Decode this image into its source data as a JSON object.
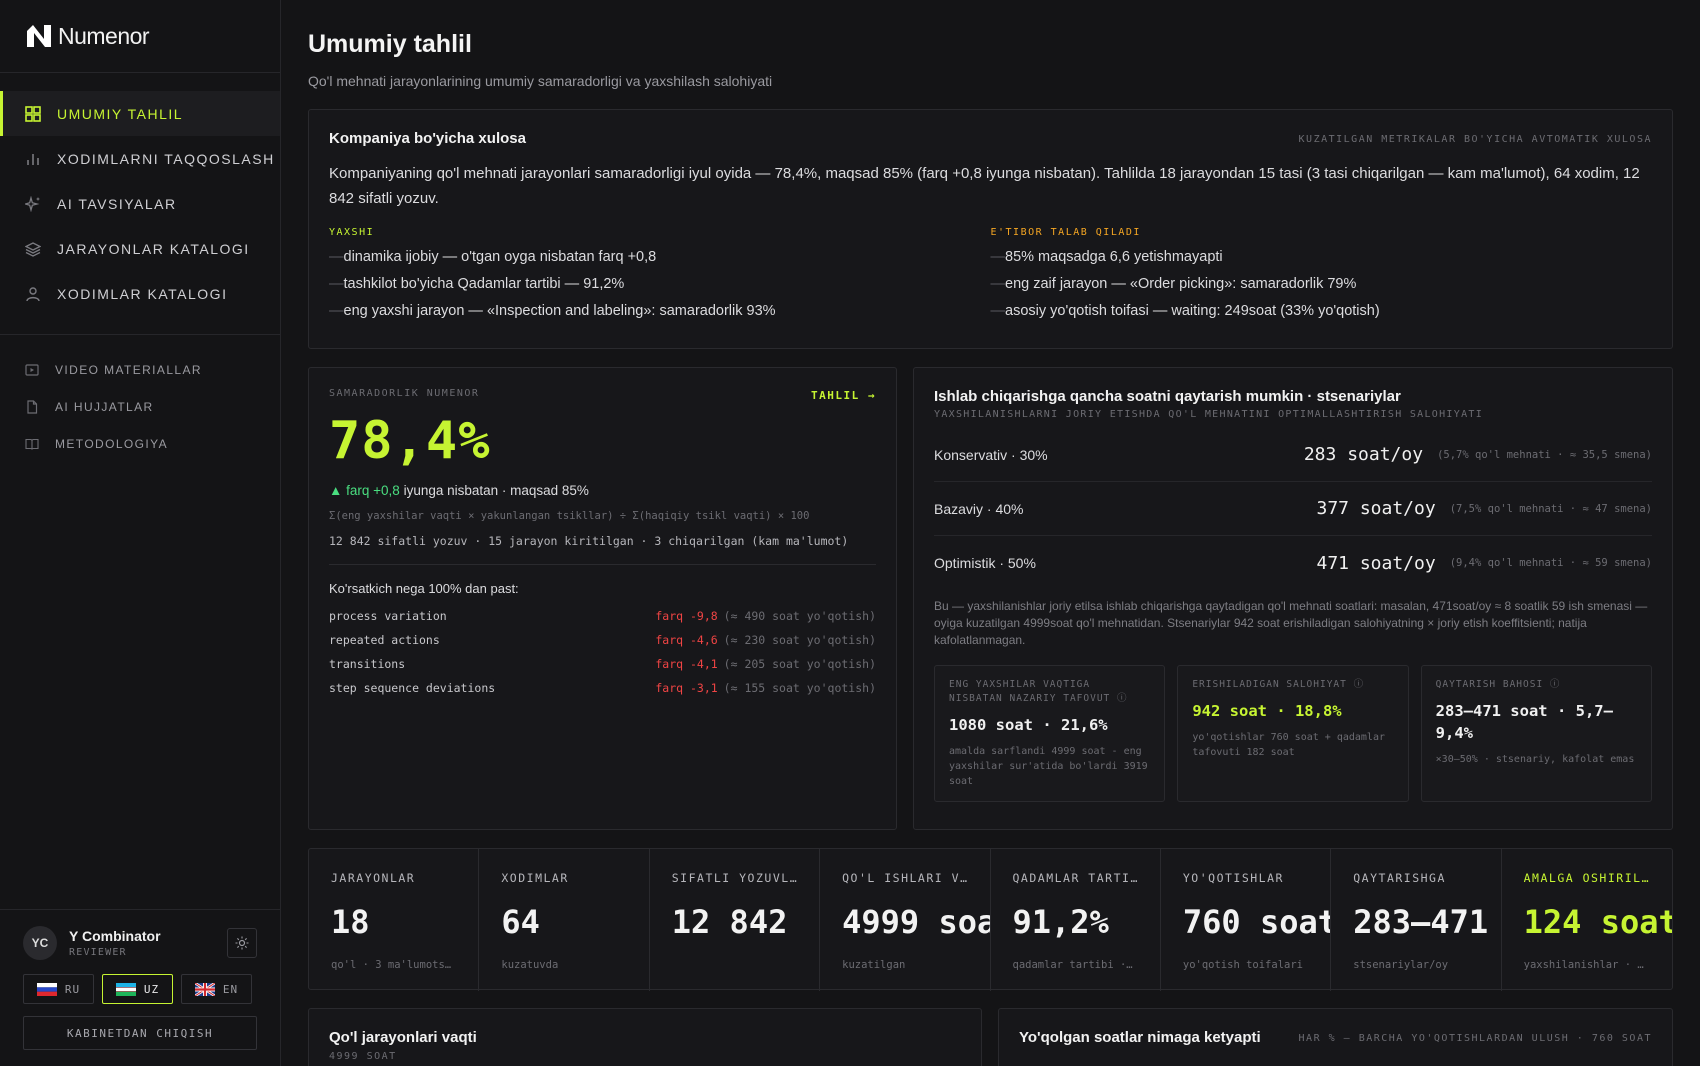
{
  "brand": {
    "name": "Numenor"
  },
  "colors": {
    "accent": "#c6f432",
    "warning": "#f5a623",
    "negative": "#ef4444",
    "positive": "#4ade80"
  },
  "sidebar": {
    "main_items": [
      {
        "label": "UMUMIY TAHLIL",
        "icon": "grid-icon",
        "active": true
      },
      {
        "label": "XODIMLARNI TAQQOSLASH",
        "icon": "bar-chart-icon"
      },
      {
        "label": "AI TAVSIYALAR",
        "icon": "sparkles-icon"
      },
      {
        "label": "JARAYONLAR KATALOGI",
        "icon": "layers-icon"
      },
      {
        "label": "XODIMLAR KATALOGI",
        "icon": "user-icon"
      }
    ],
    "secondary_items": [
      {
        "label": "VIDEO MATERIALLAR",
        "icon": "video-icon"
      },
      {
        "label": "AI HUJJATLAR",
        "icon": "document-icon"
      },
      {
        "label": "METODOLOGIYA",
        "icon": "book-icon"
      }
    ],
    "user": {
      "initials": "YC",
      "name": "Y Combinator",
      "role": "REVIEWER"
    },
    "languages": [
      {
        "code": "RU",
        "active": false
      },
      {
        "code": "UZ",
        "active": true
      },
      {
        "code": "EN",
        "active": false
      }
    ],
    "logout_label": "KABINETDAN CHIQISH"
  },
  "page": {
    "title": "Umumiy tahlil",
    "subtitle": "Qo'l mehnati jarayonlarining umumiy samaradorligi va yaxshilash salohiyati"
  },
  "summary": {
    "title": "Kompaniya bo'yicha xulosa",
    "tag": "KUZATILGAN METRIKALAR BO'YICHA AVTOMATIK XULOSA",
    "text": "Kompaniyaning qo'l mehnati jarayonlari samaradorligi iyul oyida — 78,4%, maqsad 85% (farq +0,8 iyunga nisbatan). Tahlilda 18 jarayondan 15 tasi (3 tasi chiqarilgan — kam ma'lumot), 64 xodim, 12 842 sifatli yozuv.",
    "good_title": "YAXSHI",
    "good": [
      "dinamika ijobiy — o'tgan oyga nisbatan farq +0,8",
      "tashkilot bo'yicha Qadamlar tartibi — 91,2%",
      "eng yaxshi jarayon — «Inspection and labeling»: samaradorlik 93%"
    ],
    "warn_title": "E'TIBOR TALAB QILADI",
    "warn": [
      "85% maqsadga 6,6 yetishmayapti",
      "eng zaif jarayon — «Order picking»: samaradorlik 79%",
      "asosiy yo'qotish toifasi — waiting: 249soat (33% yo'qotish)"
    ]
  },
  "efficiency": {
    "label": "SAMARADORLIK NUMENOR",
    "link": "TAHLIL →",
    "value": "78,4%",
    "delta_arrow": "▲",
    "delta_value": "farq +0,8",
    "delta_text": " iyunga nisbatan · maqsad 85%",
    "formula": "Σ(eng yaxshilar vaqti × yakunlangan tsikllar) ÷ Σ(haqiqiy tsikl vaqti) × 100",
    "meta": "12 842 sifatli yozuv · 15 jarayon kiritilgan · 3 chiqarilgan (kam ma'lumot)",
    "why_title": "Ko'rsatkich nega 100% dan past:",
    "losses": [
      {
        "name": "process variation",
        "value": "farq -9,8",
        "hours": "(≈ 490 soat yo'qotish)"
      },
      {
        "name": "repeated actions",
        "value": "farq -4,6",
        "hours": "(≈ 230 soat yo'qotish)"
      },
      {
        "name": "transitions",
        "value": "farq -4,1",
        "hours": "(≈ 205 soat yo'qotish)"
      },
      {
        "name": "step sequence deviations",
        "value": "farq -3,1",
        "hours": "(≈ 155 soat yo'qotish)"
      }
    ]
  },
  "scenarios": {
    "title": "Ishlab chiqarishga qancha soatni qaytarish mumkin · stsenariylar",
    "subtitle": "YAXSHILANISHLARNI JORIY ETISHDA QO'L MEHNATINI OPTIMALLASHTIRISH SALOHIYATI",
    "rows": [
      {
        "name": "Konservativ · 30%",
        "value": "283 soat/oy",
        "note": "(5,7% qo'l mehnati · ≈ 35,5 smena)"
      },
      {
        "name": "Bazaviy · 40%",
        "value": "377 soat/oy",
        "note": "(7,5% qo'l mehnati · ≈ 47 smena)"
      },
      {
        "name": "Optimistik · 50%",
        "value": "471 soat/oy",
        "note": "(9,4% qo'l mehnati · ≈ 59 smena)"
      }
    ],
    "description": "Bu — yaxshilanishlar joriy etilsa ishlab chiqarishga qaytadigan qo'l mehnati soatlari: masalan, 471soat/oy ≈ 8 soatlik 59 ish smenasi — oyiga kuzatilgan 4999soat qo'l mehnatidan. Stsenariylar 942 soat erishiladigan salohiyatning × joriy etish koeffitsienti; natija kafolatlanmagan.",
    "minis": [
      {
        "label": "ENG YAXSHILAR VAQTIGA NISBATAN NAZARIY TAFOVUT ⓘ",
        "value": "1080 soat · 21,6%",
        "note": "amalda sarflandi 4999 soat - eng yaxshilar sur'atida bo'lardi 3919 soat",
        "lime": false
      },
      {
        "label": "ERISHILADIGAN SALOHIYAT ⓘ",
        "value": "942 soat · 18,8%",
        "note": "yo'qotishlar 760 soat + qadamlar tafovuti 182 soat",
        "lime": true
      },
      {
        "label": "QAYTARISH BAHOSI ⓘ",
        "value": "283–471 soat · 5,7–9,4%",
        "note": "×30–50% · stsenariy, kafolat emas",
        "lime": false
      }
    ]
  },
  "kpis": [
    {
      "label": "JARAYONLAR",
      "value": "18",
      "sub": "qo'l · 3 ma'lumotsiz",
      "lime": false
    },
    {
      "label": "XODIMLAR",
      "value": "64",
      "sub": "kuzatuvda",
      "lime": false
    },
    {
      "label": "SIFATLI YOZUVLAR",
      "value": "12 842",
      "sub": "",
      "lime": false
    },
    {
      "label": "QO'L ISHLARI VA…",
      "value": "4999 soa",
      "sub": "kuzatilgan",
      "lime": false
    },
    {
      "label": "QADAMLAR TARTIBI",
      "value": "91,2%",
      "sub": "qadamlar tartibi · …",
      "lime": false
    },
    {
      "label": "YO'QOTISHLAR",
      "value": "760 soat",
      "sub": "yo'qotish toifalari",
      "lime": false
    },
    {
      "label": "QAYTARISHGA",
      "value": "283–471",
      "sub": "stsenariylar/oy",
      "lime": false
    },
    {
      "label": "AMALGA OSHIRILG…",
      "value": "124 soat",
      "sub": "yaxshilanishlar · i…",
      "lime": true
    }
  ],
  "bottom": {
    "left_title": "Qo'l jarayonlari vaqti",
    "left_sub": "4999 SOAT",
    "right_title": "Yo'qolgan soatlar nimaga ketyapti",
    "right_tag": "HAR % — BARCHA YO'QOTISHLARDAN ULUSH · 760 SOAT"
  }
}
